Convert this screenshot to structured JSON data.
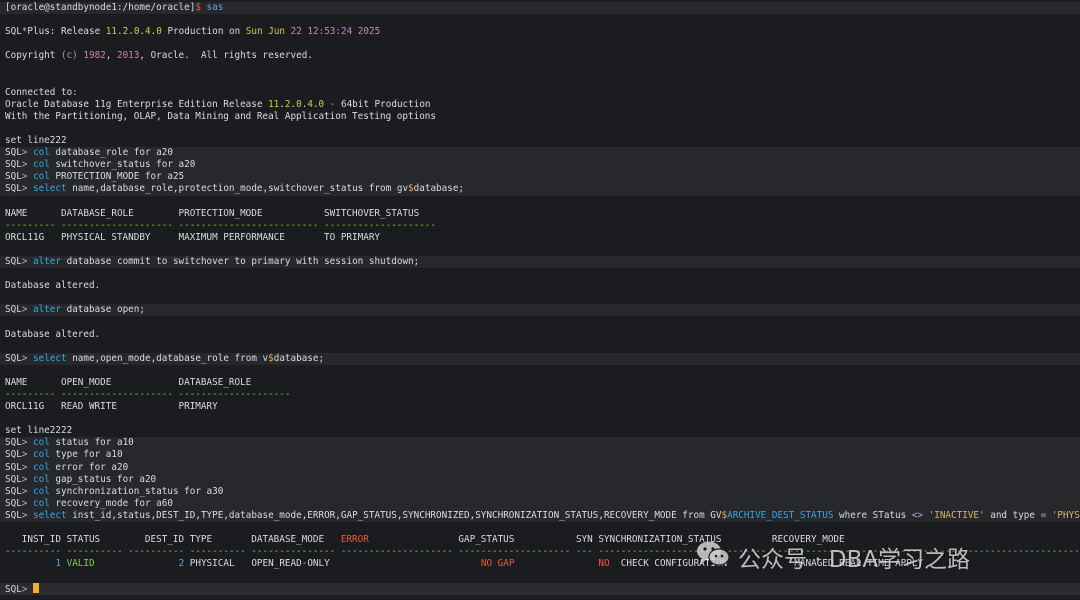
{
  "terminal": {
    "lines": [
      {
        "hl": true,
        "segs": [
          [
            "[oracle@standbynode1:/home/oracle]",
            ""
          ],
          [
            "$",
            "t-red"
          ],
          [
            " sas",
            "t-blue"
          ]
        ]
      },
      {
        "segs": []
      },
      {
        "segs": [
          [
            "SQL",
            ""
          ],
          [
            "*",
            "t-op"
          ],
          [
            "Plus: Release ",
            ""
          ],
          [
            "11",
            "t-num"
          ],
          [
            ".",
            ""
          ],
          [
            "2",
            "t-num"
          ],
          [
            ".",
            ""
          ],
          [
            "0",
            "t-num"
          ],
          [
            ".",
            ""
          ],
          [
            "4",
            "t-num"
          ],
          [
            ".",
            ""
          ],
          [
            "0",
            "t-num"
          ],
          [
            " Production on ",
            ""
          ],
          [
            "Sun Jun ",
            "t-num"
          ],
          [
            "22 12:53:24 2025",
            "t-ghl"
          ]
        ]
      },
      {
        "segs": []
      },
      {
        "segs": [
          [
            "Copyright ",
            ""
          ],
          [
            "(c)",
            "t-ghl"
          ],
          [
            " ",
            ""
          ],
          [
            "1982",
            "t-ghl"
          ],
          [
            ", ",
            ""
          ],
          [
            "2013",
            "t-ghl"
          ],
          [
            ", Oracle.  All rights reserved.",
            ""
          ]
        ]
      },
      {
        "segs": []
      },
      {
        "segs": []
      },
      {
        "segs": [
          [
            "Connected to",
            ""
          ],
          [
            ":",
            "t-op"
          ]
        ]
      },
      {
        "segs": [
          [
            "Oracle Database 11g Enterprise Edition Release ",
            ""
          ],
          [
            "11",
            "t-num"
          ],
          [
            ".",
            ""
          ],
          [
            "2",
            "t-num"
          ],
          [
            ".",
            ""
          ],
          [
            "0",
            "t-num"
          ],
          [
            ".",
            ""
          ],
          [
            "4",
            "t-num"
          ],
          [
            ".",
            ""
          ],
          [
            "0",
            "t-num"
          ],
          [
            " ",
            ""
          ],
          [
            "-",
            "t-op"
          ],
          [
            " 64bit Production",
            ""
          ]
        ]
      },
      {
        "segs": [
          [
            "With the Partitioning, OLAP, Data Mining and Real Application Testing options",
            ""
          ]
        ]
      },
      {
        "segs": []
      },
      {
        "segs": [
          [
            "set line222",
            ""
          ]
        ]
      },
      {
        "hl": true,
        "segs": [
          [
            "SQL",
            ""
          ],
          [
            ">",
            "t-op"
          ],
          [
            " ",
            ""
          ],
          [
            "col",
            "t-kw"
          ],
          [
            " database_role for a20",
            ""
          ]
        ]
      },
      {
        "hl": true,
        "segs": [
          [
            "SQL",
            ""
          ],
          [
            ">",
            "t-op"
          ],
          [
            " ",
            ""
          ],
          [
            "col",
            "t-kw"
          ],
          [
            " switchover_status for a20",
            ""
          ]
        ]
      },
      {
        "hl": true,
        "segs": [
          [
            "SQL",
            ""
          ],
          [
            ">",
            "t-op"
          ],
          [
            " ",
            ""
          ],
          [
            "col",
            "t-kw"
          ],
          [
            " PROTECTION_MODE for a25",
            ""
          ]
        ]
      },
      {
        "hl": true,
        "segs": [
          [
            "SQL",
            ""
          ],
          [
            ">",
            "t-op"
          ],
          [
            " ",
            ""
          ],
          [
            "select",
            "t-kw"
          ],
          [
            " name,database_role,protection_mode,switchover_status from gv",
            ""
          ],
          [
            "$",
            "t-sym"
          ],
          [
            "database;",
            ""
          ]
        ]
      },
      {
        "segs": []
      },
      {
        "segs": [
          [
            "NAME      DATABASE_ROLE        PROTECTION_MODE           SWITCHOVER_STATUS",
            ""
          ]
        ]
      },
      {
        "segs": [
          [
            "--------- -------------------- ------------------------- --------------------",
            "t-dash"
          ]
        ]
      },
      {
        "segs": [
          [
            "ORCL11G   PHYSICAL STANDBY     MAXIMUM PERFORMANCE       TO PRIMARY",
            ""
          ]
        ]
      },
      {
        "segs": []
      },
      {
        "hl": true,
        "segs": [
          [
            "SQL",
            ""
          ],
          [
            ">",
            "t-op"
          ],
          [
            " ",
            ""
          ],
          [
            "alter",
            "t-kw"
          ],
          [
            " database commit to switchover to primary with session shutdown;",
            ""
          ]
        ]
      },
      {
        "segs": []
      },
      {
        "segs": [
          [
            "Database altered.",
            ""
          ]
        ]
      },
      {
        "segs": []
      },
      {
        "hl": true,
        "segs": [
          [
            "SQL",
            ""
          ],
          [
            ">",
            "t-op"
          ],
          [
            " ",
            ""
          ],
          [
            "alter",
            "t-kw"
          ],
          [
            " database open;",
            ""
          ]
        ]
      },
      {
        "segs": []
      },
      {
        "segs": [
          [
            "Database altered.",
            ""
          ]
        ]
      },
      {
        "segs": []
      },
      {
        "hl": true,
        "segs": [
          [
            "SQL",
            ""
          ],
          [
            ">",
            "t-op"
          ],
          [
            " ",
            ""
          ],
          [
            "select",
            "t-kw"
          ],
          [
            " name,open_mode,database_role from v",
            ""
          ],
          [
            "$",
            "t-sym"
          ],
          [
            "database;",
            ""
          ]
        ]
      },
      {
        "segs": []
      },
      {
        "segs": [
          [
            "NAME      OPEN_MODE            DATABASE_ROLE",
            ""
          ]
        ]
      },
      {
        "segs": [
          [
            "--------- -------------------- --------------------",
            "t-dash"
          ]
        ]
      },
      {
        "segs": [
          [
            "ORCL11G   READ WRITE           PRIMARY",
            ""
          ]
        ]
      },
      {
        "segs": []
      },
      {
        "segs": [
          [
            "set line2222",
            ""
          ]
        ]
      },
      {
        "hl": true,
        "segs": [
          [
            "SQL",
            ""
          ],
          [
            ">",
            "t-op"
          ],
          [
            " ",
            ""
          ],
          [
            "col",
            "t-kw"
          ],
          [
            " status for a10",
            ""
          ]
        ]
      },
      {
        "hl": true,
        "segs": [
          [
            "SQL",
            ""
          ],
          [
            ">",
            "t-op"
          ],
          [
            " ",
            ""
          ],
          [
            "col",
            "t-kw"
          ],
          [
            " type for a10",
            ""
          ]
        ]
      },
      {
        "hl": true,
        "segs": [
          [
            "SQL",
            ""
          ],
          [
            ">",
            "t-op"
          ],
          [
            " ",
            ""
          ],
          [
            "col",
            "t-kw"
          ],
          [
            " error for a20",
            ""
          ]
        ]
      },
      {
        "hl": true,
        "segs": [
          [
            "SQL",
            ""
          ],
          [
            ">",
            "t-op"
          ],
          [
            " ",
            ""
          ],
          [
            "col",
            "t-kw"
          ],
          [
            " gap_status for a20",
            ""
          ]
        ]
      },
      {
        "hl": true,
        "segs": [
          [
            "SQL",
            ""
          ],
          [
            ">",
            "t-op"
          ],
          [
            " ",
            ""
          ],
          [
            "col",
            "t-kw"
          ],
          [
            " synchronization_status for a30",
            ""
          ]
        ]
      },
      {
        "hl": true,
        "segs": [
          [
            "SQL",
            ""
          ],
          [
            ">",
            "t-op"
          ],
          [
            " ",
            ""
          ],
          [
            "col",
            "t-kw"
          ],
          [
            " recovery_mode for a60",
            ""
          ]
        ]
      },
      {
        "hl": true,
        "segs": [
          [
            "SQL",
            ""
          ],
          [
            ">",
            "t-op"
          ],
          [
            " ",
            ""
          ],
          [
            "select",
            "t-kw"
          ],
          [
            " inst_id,status,DEST_ID,TYPE,database_mode,ERROR,GAP_STATUS,SYNCHRONIZED,SYNCHRONIZATION_STATUS,RECOVERY_MODE from GV",
            ""
          ],
          [
            "$",
            "t-sym"
          ],
          [
            "ARCHIVE_DEST_STATUS",
            "t-kw"
          ],
          [
            " where STatus ",
            ""
          ],
          [
            "<>",
            "t-op"
          ],
          [
            " ",
            ""
          ],
          [
            "'INACTIVE'",
            "t-str"
          ],
          [
            " and type ",
            ""
          ],
          [
            "=",
            "t-op"
          ],
          [
            " ",
            ""
          ],
          [
            "'PHYSICAL'",
            "t-str"
          ],
          [
            ";",
            ""
          ]
        ]
      },
      {
        "segs": []
      },
      {
        "segs": [
          [
            "   INST_ID STATUS        DEST_ID TYPE       DATABASE_MODE   ",
            ""
          ],
          [
            "ERROR",
            "t-red"
          ],
          [
            "                GAP_STATUS           SYN SYNCHRONIZATION_STATUS         RECOVERY_MODE",
            ""
          ]
        ]
      },
      {
        "segs": [
          [
            "---------- ---------- ---------- ---------- --------------- -------------------- -------------------- --- ------------------------------ ------------------------------------------------------------",
            "t-dash"
          ]
        ]
      },
      {
        "segs": [
          [
            "         ",
            ""
          ],
          [
            "1",
            "t-blue"
          ],
          [
            " ",
            ""
          ],
          [
            "VALID",
            "t-green"
          ],
          [
            "               ",
            ""
          ],
          [
            "2",
            "t-blue"
          ],
          [
            " PHYSICAL   OPEN_READ",
            ""
          ],
          [
            "-",
            "t-op"
          ],
          [
            "ONLY                           ",
            ""
          ],
          [
            "NO GAP",
            "t-red"
          ],
          [
            "               ",
            ""
          ],
          [
            "NO",
            "t-red"
          ],
          [
            "  CHECK CONFIGURATION            MANAGED REAL TIME APPLY",
            ""
          ]
        ]
      },
      {
        "segs": []
      },
      {
        "prompt": true,
        "segs": [
          [
            "SQL",
            ""
          ],
          [
            ">",
            "t-op"
          ],
          [
            " ",
            ""
          ]
        ]
      }
    ]
  },
  "watermark": {
    "text": "公众号 · DBA学习之路",
    "icon": "wechat-icon"
  }
}
